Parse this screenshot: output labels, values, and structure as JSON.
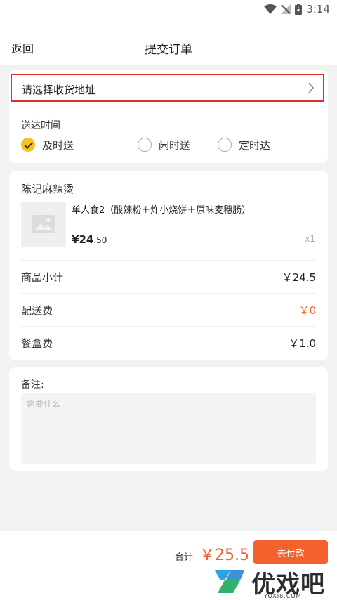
{
  "status_bar": {
    "time": "3:14",
    "icons": [
      "wifi-icon",
      "no-signal-icon",
      "battery-charging-icon"
    ]
  },
  "header": {
    "back_label": "返回",
    "title": "提交订单"
  },
  "address": {
    "label": "请选择收货地址",
    "icon": "chevron-right-icon"
  },
  "delivery": {
    "title": "送达时间",
    "options": [
      {
        "label": "及时送",
        "checked": true
      },
      {
        "label": "闲时送",
        "checked": false
      },
      {
        "label": "定时达",
        "checked": false
      }
    ]
  },
  "order": {
    "shop_name": "陈记麻辣烫",
    "item": {
      "name": "单人食2（酸辣粉＋炸小烧饼＋原味麦穗肠）",
      "price_symbol": "¥",
      "price_int": "24",
      "price_dec": ".50",
      "qty": "x1",
      "image_icon": "image-placeholder-icon"
    },
    "summary": [
      {
        "label": "商品小计",
        "value": "￥24.5"
      },
      {
        "label": "配送费",
        "value": "￥0"
      },
      {
        "label": "餐盒费",
        "value": "￥1.0"
      }
    ]
  },
  "remark": {
    "label": "备注:",
    "placeholder": "需要什么"
  },
  "footer": {
    "total_label": "合计",
    "total_amount": "￥25.5",
    "pay_label": "去付款"
  },
  "watermark": {
    "text": "优戏吧",
    "sub": "YOXI8.COM"
  },
  "colors": {
    "accent": "#f5612d",
    "check": "#f9c31f",
    "highlight_border": "#e02b2b",
    "background": "#f2f2f2"
  }
}
